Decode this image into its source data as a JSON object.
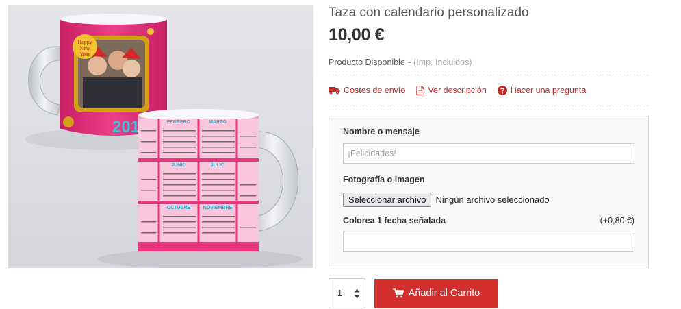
{
  "product": {
    "title": "Taza con calendario personalizado",
    "price": "10,00 €",
    "availability": "Producto Disponible",
    "separator": "-",
    "tax_note": "(Imp. Incluidos)"
  },
  "links": [
    {
      "label": "Costes de envío",
      "icon": "truck-icon"
    },
    {
      "label": "Ver descripción",
      "icon": "document-icon"
    },
    {
      "label": "Hacer una pregunta",
      "icon": "question-circle-icon"
    }
  ],
  "form": {
    "message": {
      "label": "Nombre o mensaje",
      "placeholder": "¡Felicidades!"
    },
    "photo": {
      "label": "Fotografía o imagen",
      "button": "Seleccionar archivo",
      "status": "Ningún archivo seleccionado"
    },
    "date": {
      "label": "Colorea 1 fecha señalada",
      "extra": "(+0,80 €)",
      "value": ""
    }
  },
  "cart": {
    "quantity": "1",
    "add_label": "Añadir al Carrito"
  },
  "mug_image": {
    "year_text": "2016",
    "months": [
      "FEBRERO",
      "MARZO",
      "JUNIO",
      "JULIO",
      "OCTUBRE",
      "NOVIEMBRE"
    ],
    "greeting": [
      "Happy",
      "New",
      "Year"
    ]
  },
  "colors": {
    "accent": "#d32f2f",
    "link": "#c62828",
    "mug_pink": "#e8357d"
  }
}
